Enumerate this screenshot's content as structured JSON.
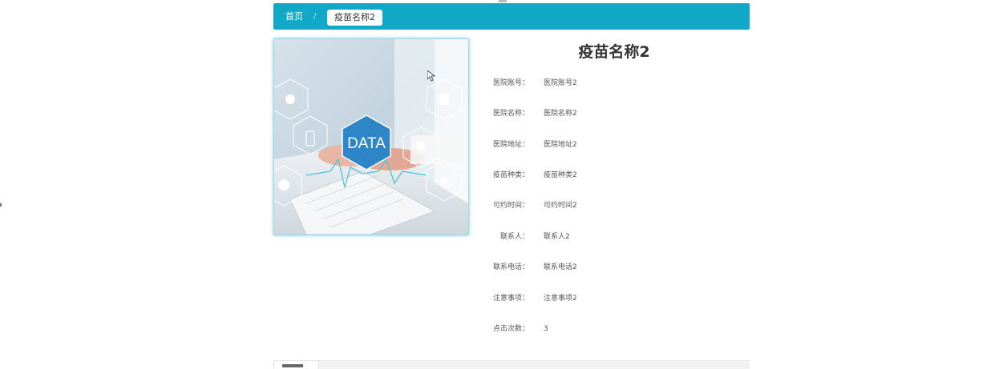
{
  "breadcrumb": {
    "home": "首页",
    "separator": "/",
    "current": "疫苗名称2"
  },
  "image": {
    "overlay_text": "DATA",
    "colors": {
      "accent": "#12a9c9",
      "hex_blue": "#2f86c6"
    }
  },
  "detail": {
    "title": "疫苗名称2",
    "fields": [
      {
        "label": "医院账号：",
        "value": "医院账号2"
      },
      {
        "label": "医院名称：",
        "value": "医院名称2"
      },
      {
        "label": "医院地址：",
        "value": "医院地址2"
      },
      {
        "label": "疫苗种类：",
        "value": "疫苗种类2"
      },
      {
        "label": "可约时间：",
        "value": "可约时间2"
      },
      {
        "label": "联系人：",
        "value": "联系人2"
      },
      {
        "label": "联系电话：",
        "value": "联系电话2"
      },
      {
        "label": "注意事项：",
        "value": "注意事项2"
      },
      {
        "label": "点击次数：",
        "value": "3"
      }
    ]
  }
}
